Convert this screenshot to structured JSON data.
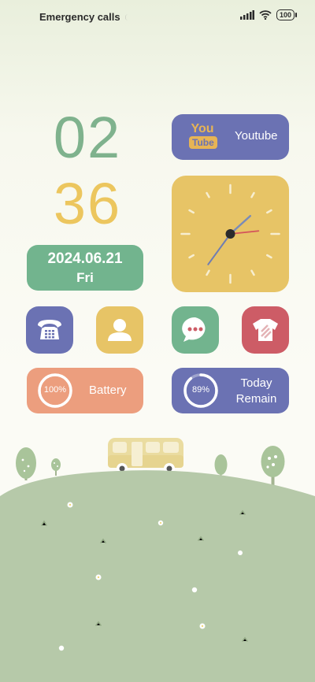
{
  "status_bar": {
    "carrier_text": "Emergency calls",
    "battery_level": "100"
  },
  "clock_widget": {
    "hour": "02",
    "minute": "36"
  },
  "date_widget": {
    "date": "2024.06.21",
    "weekday": "Fri"
  },
  "youtube_widget": {
    "logo_top": "You",
    "logo_bottom": "Tube",
    "label": "Youtube"
  },
  "analog_clock": {
    "hour_hand_deg": 48,
    "minute_hand_deg": 216,
    "second_hand_deg": 84
  },
  "apps": [
    {
      "name": "Phone",
      "icon": "phone-icon"
    },
    {
      "name": "Contacts",
      "icon": "contacts-icon"
    },
    {
      "name": "Messages",
      "icon": "messages-icon"
    },
    {
      "name": "Themes",
      "icon": "theme-icon"
    }
  ],
  "battery_widget": {
    "percent_text": "100%",
    "percent": 100,
    "label": "Battery"
  },
  "today_widget": {
    "percent_text": "89%",
    "percent": 89,
    "label_line1": "Today",
    "label_line2": "Remain"
  },
  "colors": {
    "green": "#72b48e",
    "yellow": "#e7c466",
    "indigo": "#6b72b3",
    "red": "#cd5c66",
    "peach": "#ec9e7e",
    "hill": "#b6c9a9"
  }
}
